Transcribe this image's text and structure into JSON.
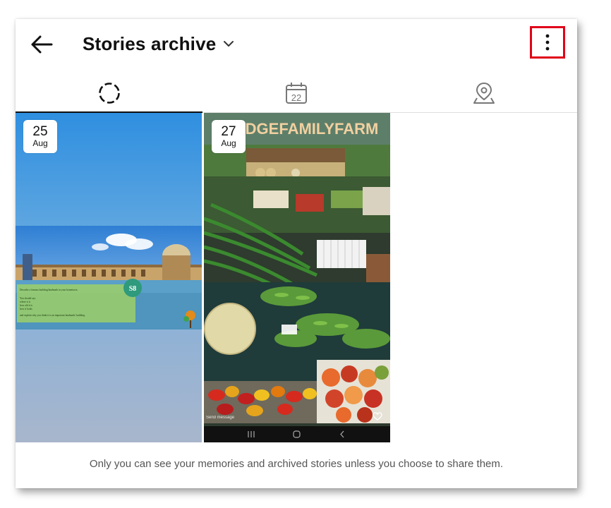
{
  "header": {
    "title": "Stories archive",
    "back_icon": "arrow-left-icon",
    "caret_icon": "chevron-down-icon",
    "more_icon": "more-vertical-icon",
    "highlight_color": "#e0001a"
  },
  "tabs": [
    {
      "name": "stories",
      "icon": "circle-dashed-icon",
      "active": true
    },
    {
      "name": "calendar",
      "icon": "calendar-icon",
      "label": "22",
      "active": false
    },
    {
      "name": "map",
      "icon": "map-pin-icon",
      "active": false
    }
  ],
  "stories": [
    {
      "day": "25",
      "month": "Aug",
      "overlay_text": {
        "badge": "S8",
        "line1": "Describe a famous building/landmark in your hometown.",
        "line2": "You should say:",
        "line3": "where it is",
        "line4": "how old it is",
        "line5": "how it looks",
        "line6": "and explain why you think it is an important landmark/ building."
      }
    },
    {
      "day": "27",
      "month": "Aug",
      "overlay_title": "EDGEFAMILYFARM",
      "send_message": "Send message"
    }
  ],
  "footer": {
    "note": "Only you can see your memories and archived stories unless you choose to share them."
  }
}
